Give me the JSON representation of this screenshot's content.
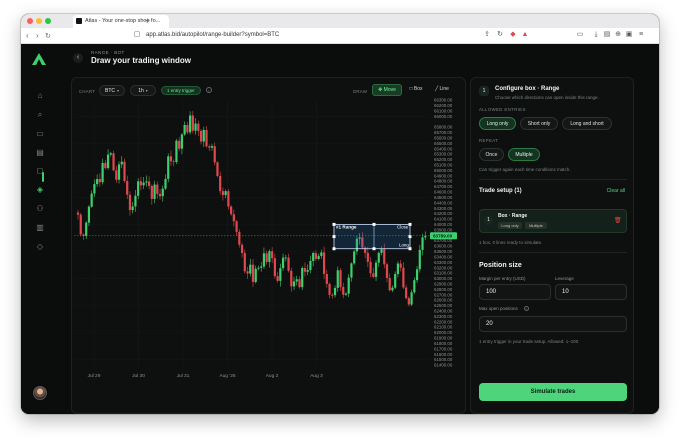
{
  "browser": {
    "tab_title": "Atlas - Your one-stop shop fo...",
    "new_tab": "+",
    "url": "app.atlas.bid/autopilot/range-builder?symbol=BTC"
  },
  "page": {
    "breadcrumb": "RANGE · BOT",
    "title": "Draw your trading window"
  },
  "toolbar": {
    "chart_label": "CHART",
    "symbol": "BTC",
    "interval": "1h",
    "trigger_badge": "1 entry trigger",
    "draw_label": "DRAW",
    "tools": [
      {
        "label": "Move",
        "icon": "move-icon",
        "active": true
      },
      {
        "label": "Box",
        "icon": "box-icon",
        "active": false
      },
      {
        "label": "Line",
        "icon": "line-icon",
        "active": false
      }
    ]
  },
  "chart_data": {
    "type": "candlestick",
    "symbol": "BTC",
    "interval": "1h",
    "x_ticks": [
      "Jul 29",
      "Jul 30",
      "Jul 31",
      "Aug '26",
      "Aug 2",
      "Aug 3"
    ],
    "y_ticks": [
      "66300.00",
      "66200.00",
      "66100.00",
      "66000.00",
      "65900.00",
      "65800.00",
      "65700.00",
      "65600.00",
      "65500.00",
      "65400.00",
      "65300.00",
      "65200.00",
      "65100.00",
      "65000.00",
      "64900.00",
      "64800.00",
      "64700.00",
      "64600.00",
      "64500.00",
      "64400.00",
      "64300.00",
      "64200.00",
      "64100.00",
      "64000.00",
      "63900.00",
      "63800.00",
      "63700.00",
      "63600.00",
      "63500.00",
      "63400.00",
      "63300.00",
      "63200.00",
      "63100.00",
      "63000.00",
      "62900.00",
      "62800.00",
      "62700.00",
      "62600.00",
      "62500.00",
      "62400.00",
      "62300.00",
      "62200.00",
      "62100.00",
      "62000.00",
      "61900.00",
      "61800.00",
      "61700.00",
      "61600.00",
      "61500.00",
      "61400.00"
    ],
    "y_tick_display": [
      "66300.00",
      "66200.00",
      "66100.00",
      "66000.00",
      "65800.00",
      "65700.00",
      "65600.00",
      "65500.00",
      "65400.00",
      "65300.00",
      "65200.00",
      "65100.00",
      "65000.00",
      "64900.00",
      "64800.00",
      "64700.00",
      "64600.00",
      "64500.00",
      "64400.00",
      "64300.00",
      "64200.00",
      "64100.00",
      "64000.00",
      "63900.00",
      "63800.00",
      "63700.00",
      "63600.00",
      "63500.00",
      "63400.00",
      "63300.00",
      "63200.00",
      "63100.00",
      "63000.00",
      "62900.00",
      "62800.00",
      "62700.00",
      "62600.00",
      "62500.00",
      "62400.00",
      "62300.00",
      "62200.00",
      "62100.00",
      "62000.00",
      "61900.00",
      "61800.00",
      "61700.00",
      "61600.00",
      "61500.00",
      "61400.00"
    ],
    "ylim": [
      61400,
      66300
    ],
    "last_price": "63789.00",
    "up_color": "#3ecf6e",
    "down_color": "#e0484f",
    "close_path": [
      64180,
      63700,
      63950,
      64300,
      64600,
      64900,
      64650,
      65150,
      65050,
      65400,
      65100,
      64800,
      65300,
      64950,
      64550,
      64200,
      64500,
      64750,
      64650,
      64900,
      64700,
      64500,
      64800,
      64400,
      64650,
      64900,
      65300,
      65050,
      65550,
      65400,
      65900,
      65650,
      66050,
      65700,
      65900,
      65450,
      65800,
      65300,
      65550,
      65100,
      64800,
      64550,
      64650,
      64350,
      64200,
      63900,
      63600,
      63350,
      63000,
      63300,
      62900,
      63250,
      63150,
      63500,
      63300,
      63600,
      63100,
      62900,
      63250,
      63400,
      63100,
      62750,
      63050,
      62850,
      63250,
      63100,
      63300,
      63450,
      63300,
      63550,
      63200,
      62900,
      62600,
      62800,
      63100,
      62800,
      62550,
      62950,
      63350,
      63500,
      63850,
      63650,
      63500,
      63150,
      62950,
      63250,
      63600,
      63400,
      63100,
      62800,
      62950,
      63250,
      63150,
      62800,
      62500,
      62750,
      63000,
      63350,
      63800,
      63789
    ],
    "box": {
      "label": "#1 Range",
      "top_price": 64000,
      "bottom_price": 63550,
      "start_index": 99,
      "end_index": 121,
      "long_label": "Long",
      "close_label": "Close"
    }
  },
  "panel": {
    "step_number": "1",
    "configure_title": "Configure box · Range",
    "configure_sub": "Choose which directions can open inside this range.",
    "allowed_label": "ALLOWED ENTRIES",
    "allowed_options": [
      {
        "label": "Long only",
        "on": true
      },
      {
        "label": "Short only",
        "on": false
      },
      {
        "label": "Long and short",
        "on": false
      }
    ],
    "repeat_label": "REPEAT",
    "repeat_options": [
      {
        "label": "Once",
        "on": false
      },
      {
        "label": "Multiple",
        "on": true
      }
    ],
    "repeat_help": "Can trigger again each time conditions match.",
    "setup_title": "Trade setup (1)",
    "clear_all": "Clear all",
    "setup_item": {
      "num": "1",
      "title": "Box · Range",
      "tags": [
        "Long only",
        "Multiple"
      ]
    },
    "setup_help": "1 box, 0 lines ready to simulate.",
    "position_title": "Position size",
    "margin_label": "Margin per entry (USD)",
    "margin_value": "100",
    "leverage_label": "Leverage",
    "leverage_value": "10",
    "max_label": "Max open positions",
    "max_value": "20",
    "max_help": "1 entry trigger in your trade setup. Allowed: 1–100",
    "simulate_label": "Simulate trades"
  }
}
